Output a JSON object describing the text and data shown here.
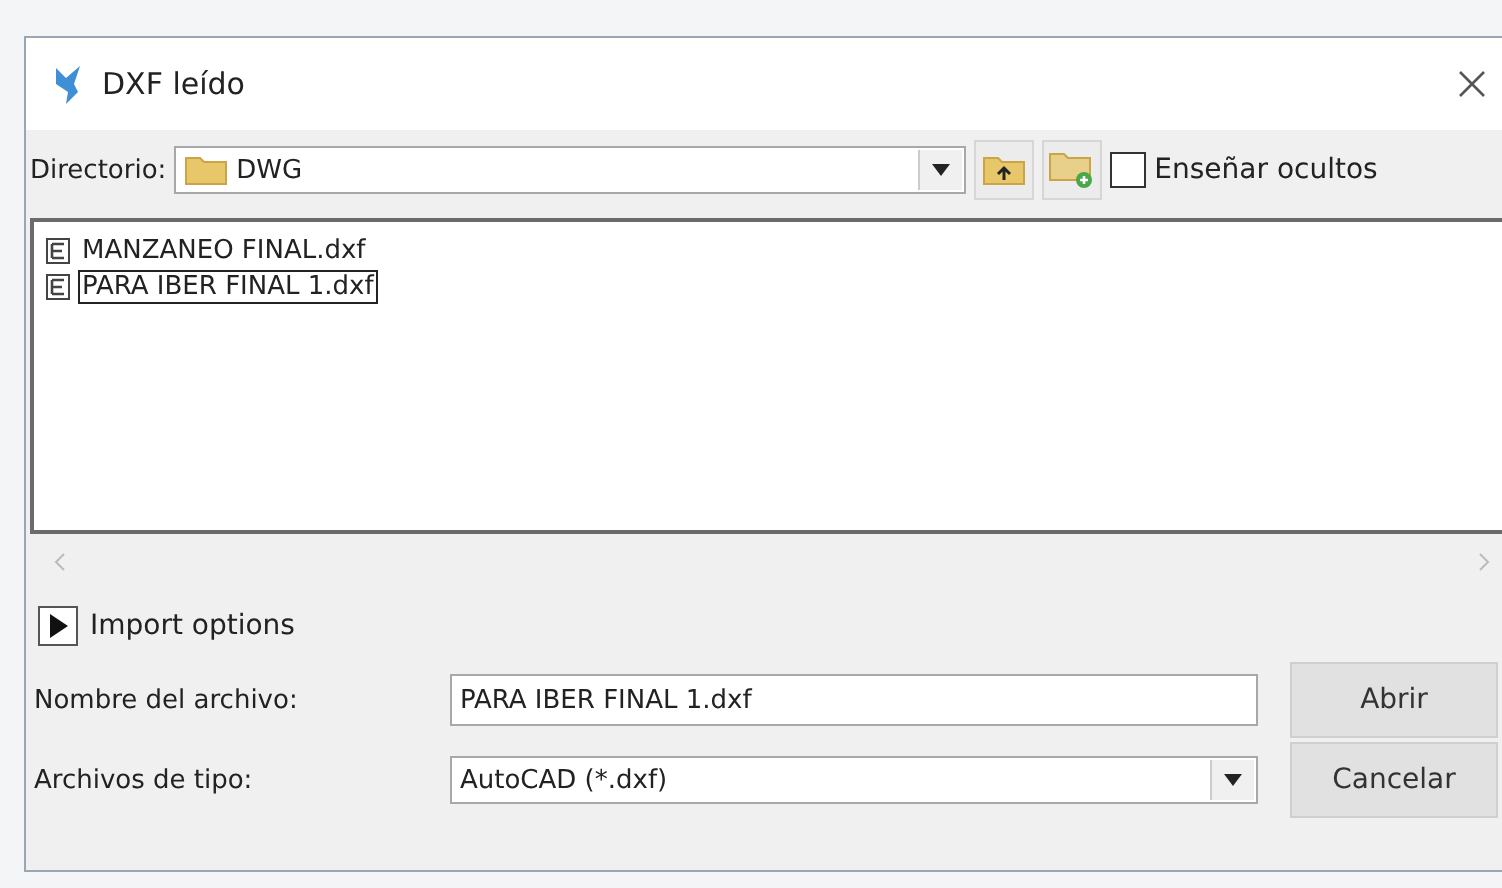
{
  "window": {
    "title": "DXF leído"
  },
  "directory": {
    "label": "Directorio:",
    "value": "DWG"
  },
  "show_hidden": {
    "label": "Enseñar ocultos",
    "checked": false
  },
  "files": [
    {
      "name": "MANZANEO FINAL.dxf",
      "selected": false
    },
    {
      "name": "PARA IBER FINAL 1.dxf",
      "selected": true
    }
  ],
  "import_options": {
    "label": "Import options",
    "expanded": false
  },
  "file_name": {
    "label": "Nombre del archivo:",
    "value": "PARA IBER FINAL 1.dxf"
  },
  "file_type": {
    "label": "Archivos de tipo:",
    "value": "AutoCAD (*.dxf)"
  },
  "buttons": [
    {
      "label": "Abrir"
    },
    {
      "label": "Cancelar"
    }
  ]
}
